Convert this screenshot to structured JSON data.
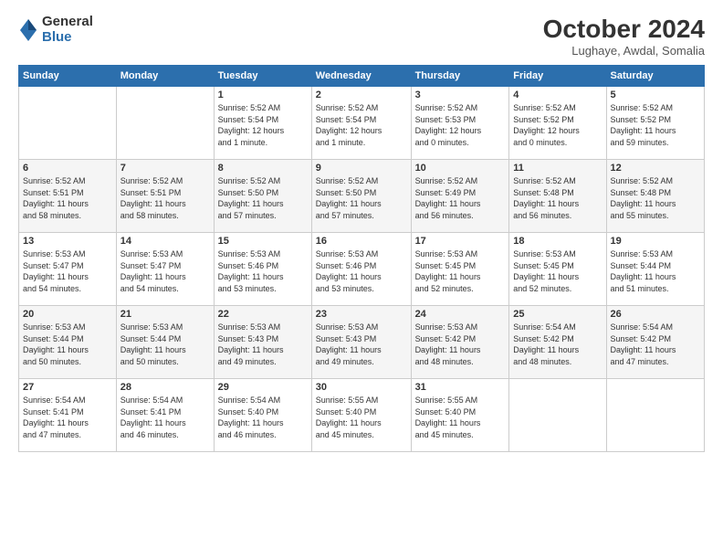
{
  "header": {
    "logo_general": "General",
    "logo_blue": "Blue",
    "title": "October 2024",
    "location": "Lughaye, Awdal, Somalia"
  },
  "calendar": {
    "days_of_week": [
      "Sunday",
      "Monday",
      "Tuesday",
      "Wednesday",
      "Thursday",
      "Friday",
      "Saturday"
    ],
    "weeks": [
      [
        {
          "day": "",
          "info": ""
        },
        {
          "day": "",
          "info": ""
        },
        {
          "day": "1",
          "info": "Sunrise: 5:52 AM\nSunset: 5:54 PM\nDaylight: 12 hours\nand 1 minute."
        },
        {
          "day": "2",
          "info": "Sunrise: 5:52 AM\nSunset: 5:54 PM\nDaylight: 12 hours\nand 1 minute."
        },
        {
          "day": "3",
          "info": "Sunrise: 5:52 AM\nSunset: 5:53 PM\nDaylight: 12 hours\nand 0 minutes."
        },
        {
          "day": "4",
          "info": "Sunrise: 5:52 AM\nSunset: 5:52 PM\nDaylight: 12 hours\nand 0 minutes."
        },
        {
          "day": "5",
          "info": "Sunrise: 5:52 AM\nSunset: 5:52 PM\nDaylight: 11 hours\nand 59 minutes."
        }
      ],
      [
        {
          "day": "6",
          "info": "Sunrise: 5:52 AM\nSunset: 5:51 PM\nDaylight: 11 hours\nand 58 minutes."
        },
        {
          "day": "7",
          "info": "Sunrise: 5:52 AM\nSunset: 5:51 PM\nDaylight: 11 hours\nand 58 minutes."
        },
        {
          "day": "8",
          "info": "Sunrise: 5:52 AM\nSunset: 5:50 PM\nDaylight: 11 hours\nand 57 minutes."
        },
        {
          "day": "9",
          "info": "Sunrise: 5:52 AM\nSunset: 5:50 PM\nDaylight: 11 hours\nand 57 minutes."
        },
        {
          "day": "10",
          "info": "Sunrise: 5:52 AM\nSunset: 5:49 PM\nDaylight: 11 hours\nand 56 minutes."
        },
        {
          "day": "11",
          "info": "Sunrise: 5:52 AM\nSunset: 5:48 PM\nDaylight: 11 hours\nand 56 minutes."
        },
        {
          "day": "12",
          "info": "Sunrise: 5:52 AM\nSunset: 5:48 PM\nDaylight: 11 hours\nand 55 minutes."
        }
      ],
      [
        {
          "day": "13",
          "info": "Sunrise: 5:53 AM\nSunset: 5:47 PM\nDaylight: 11 hours\nand 54 minutes."
        },
        {
          "day": "14",
          "info": "Sunrise: 5:53 AM\nSunset: 5:47 PM\nDaylight: 11 hours\nand 54 minutes."
        },
        {
          "day": "15",
          "info": "Sunrise: 5:53 AM\nSunset: 5:46 PM\nDaylight: 11 hours\nand 53 minutes."
        },
        {
          "day": "16",
          "info": "Sunrise: 5:53 AM\nSunset: 5:46 PM\nDaylight: 11 hours\nand 53 minutes."
        },
        {
          "day": "17",
          "info": "Sunrise: 5:53 AM\nSunset: 5:45 PM\nDaylight: 11 hours\nand 52 minutes."
        },
        {
          "day": "18",
          "info": "Sunrise: 5:53 AM\nSunset: 5:45 PM\nDaylight: 11 hours\nand 52 minutes."
        },
        {
          "day": "19",
          "info": "Sunrise: 5:53 AM\nSunset: 5:44 PM\nDaylight: 11 hours\nand 51 minutes."
        }
      ],
      [
        {
          "day": "20",
          "info": "Sunrise: 5:53 AM\nSunset: 5:44 PM\nDaylight: 11 hours\nand 50 minutes."
        },
        {
          "day": "21",
          "info": "Sunrise: 5:53 AM\nSunset: 5:44 PM\nDaylight: 11 hours\nand 50 minutes."
        },
        {
          "day": "22",
          "info": "Sunrise: 5:53 AM\nSunset: 5:43 PM\nDaylight: 11 hours\nand 49 minutes."
        },
        {
          "day": "23",
          "info": "Sunrise: 5:53 AM\nSunset: 5:43 PM\nDaylight: 11 hours\nand 49 minutes."
        },
        {
          "day": "24",
          "info": "Sunrise: 5:53 AM\nSunset: 5:42 PM\nDaylight: 11 hours\nand 48 minutes."
        },
        {
          "day": "25",
          "info": "Sunrise: 5:54 AM\nSunset: 5:42 PM\nDaylight: 11 hours\nand 48 minutes."
        },
        {
          "day": "26",
          "info": "Sunrise: 5:54 AM\nSunset: 5:42 PM\nDaylight: 11 hours\nand 47 minutes."
        }
      ],
      [
        {
          "day": "27",
          "info": "Sunrise: 5:54 AM\nSunset: 5:41 PM\nDaylight: 11 hours\nand 47 minutes."
        },
        {
          "day": "28",
          "info": "Sunrise: 5:54 AM\nSunset: 5:41 PM\nDaylight: 11 hours\nand 46 minutes."
        },
        {
          "day": "29",
          "info": "Sunrise: 5:54 AM\nSunset: 5:40 PM\nDaylight: 11 hours\nand 46 minutes."
        },
        {
          "day": "30",
          "info": "Sunrise: 5:55 AM\nSunset: 5:40 PM\nDaylight: 11 hours\nand 45 minutes."
        },
        {
          "day": "31",
          "info": "Sunrise: 5:55 AM\nSunset: 5:40 PM\nDaylight: 11 hours\nand 45 minutes."
        },
        {
          "day": "",
          "info": ""
        },
        {
          "day": "",
          "info": ""
        }
      ]
    ]
  }
}
